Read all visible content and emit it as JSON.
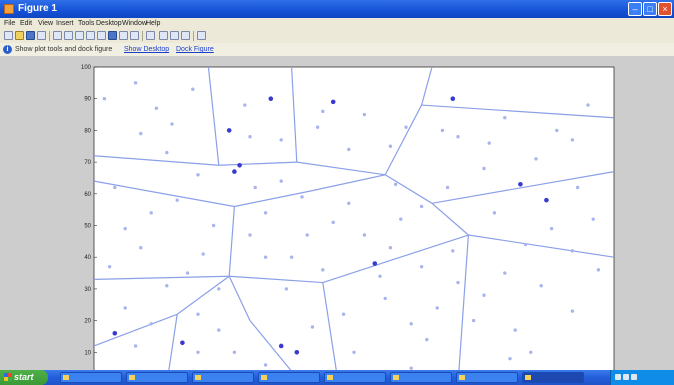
{
  "window": {
    "title": "Figure 1"
  },
  "menu": [
    "File",
    "Edit",
    "View",
    "Insert",
    "Tools",
    "Desktop",
    "Window",
    "Help"
  ],
  "infobar": {
    "text": "Show plot tools and dock figure",
    "link1": "Show Desktop",
    "link2": "Dock Figure"
  },
  "chart_data": {
    "type": "scatter",
    "title": "",
    "xlabel": "",
    "ylabel": "",
    "xlim": [
      0,
      100
    ],
    "ylim": [
      0,
      100
    ],
    "xticks": [
      0,
      10,
      20,
      30,
      40,
      50,
      60,
      70,
      80,
      90,
      100
    ],
    "yticks": [
      0,
      10,
      20,
      30,
      40,
      50,
      60,
      70,
      80,
      90,
      100
    ],
    "colors": {
      "edges": "#8ba0e8",
      "sites": "#3a3ad0",
      "points": "#a9b4ec"
    },
    "sites": [
      [
        34,
        90
      ],
      [
        46,
        89
      ],
      [
        26,
        80
      ],
      [
        27,
        67
      ],
      [
        28,
        69
      ],
      [
        54,
        38
      ],
      [
        4,
        16
      ],
      [
        17,
        13
      ],
      [
        36,
        12
      ],
      [
        82,
        63
      ],
      [
        69,
        90
      ],
      [
        87,
        58
      ],
      [
        39,
        10
      ]
    ],
    "voronoi_edges": [
      [
        [
          0,
          72
        ],
        [
          24,
          69
        ]
      ],
      [
        [
          24,
          69
        ],
        [
          22,
          100
        ]
      ],
      [
        [
          24,
          69
        ],
        [
          39,
          70
        ]
      ],
      [
        [
          39,
          70
        ],
        [
          38,
          100
        ]
      ],
      [
        [
          39,
          70
        ],
        [
          56,
          66
        ]
      ],
      [
        [
          56,
          66
        ],
        [
          63,
          88
        ]
      ],
      [
        [
          63,
          88
        ],
        [
          65,
          100
        ]
      ],
      [
        [
          63,
          88
        ],
        [
          100,
          84
        ]
      ],
      [
        [
          56,
          66
        ],
        [
          65,
          57
        ]
      ],
      [
        [
          65,
          57
        ],
        [
          100,
          67
        ]
      ],
      [
        [
          65,
          57
        ],
        [
          72,
          47
        ]
      ],
      [
        [
          72,
          47
        ],
        [
          100,
          40
        ]
      ],
      [
        [
          72,
          47
        ],
        [
          70,
          0
        ]
      ],
      [
        [
          56,
          66
        ],
        [
          42,
          61
        ]
      ],
      [
        [
          42,
          61
        ],
        [
          27,
          56
        ]
      ],
      [
        [
          27,
          56
        ],
        [
          0,
          64
        ]
      ],
      [
        [
          27,
          56
        ],
        [
          26,
          34
        ]
      ],
      [
        [
          26,
          34
        ],
        [
          0,
          33
        ]
      ],
      [
        [
          26,
          34
        ],
        [
          44,
          32
        ]
      ],
      [
        [
          44,
          32
        ],
        [
          72,
          47
        ]
      ],
      [
        [
          44,
          32
        ],
        [
          47,
          0
        ]
      ],
      [
        [
          26,
          34
        ],
        [
          16,
          22
        ]
      ],
      [
        [
          16,
          22
        ],
        [
          14,
          0
        ]
      ],
      [
        [
          26,
          34
        ],
        [
          30,
          20
        ]
      ],
      [
        [
          30,
          20
        ],
        [
          40,
          0
        ]
      ],
      [
        [
          16,
          22
        ],
        [
          0,
          12
        ]
      ]
    ],
    "points": [
      [
        8,
        95
      ],
      [
        12,
        87
      ],
      [
        19,
        93
      ],
      [
        9,
        79
      ],
      [
        15,
        82
      ],
      [
        44,
        86
      ],
      [
        29,
        88
      ],
      [
        36,
        77
      ],
      [
        52,
        85
      ],
      [
        57,
        75
      ],
      [
        49,
        74
      ],
      [
        60,
        81
      ],
      [
        67,
        80
      ],
      [
        70,
        78
      ],
      [
        76,
        76
      ],
      [
        79,
        84
      ],
      [
        89,
        80
      ],
      [
        92,
        77
      ],
      [
        85,
        71
      ],
      [
        75,
        68
      ],
      [
        68,
        62
      ],
      [
        63,
        56
      ],
      [
        59,
        52
      ],
      [
        52,
        47
      ],
      [
        46,
        51
      ],
      [
        40,
        59
      ],
      [
        36,
        64
      ],
      [
        31,
        62
      ],
      [
        33,
        54
      ],
      [
        30,
        47
      ],
      [
        23,
        50
      ],
      [
        21,
        41
      ],
      [
        18,
        35
      ],
      [
        14,
        31
      ],
      [
        9,
        43
      ],
      [
        11,
        54
      ],
      [
        6,
        49
      ],
      [
        3,
        37
      ],
      [
        6,
        24
      ],
      [
        11,
        19
      ],
      [
        20,
        22
      ],
      [
        24,
        17
      ],
      [
        27,
        10
      ],
      [
        33,
        6
      ],
      [
        42,
        18
      ],
      [
        48,
        22
      ],
      [
        56,
        27
      ],
      [
        61,
        19
      ],
      [
        66,
        24
      ],
      [
        64,
        14
      ],
      [
        75,
        28
      ],
      [
        79,
        35
      ],
      [
        86,
        31
      ],
      [
        92,
        42
      ],
      [
        97,
        36
      ],
      [
        96,
        52
      ],
      [
        83,
        44
      ],
      [
        77,
        54
      ],
      [
        88,
        49
      ],
      [
        81,
        17
      ],
      [
        84,
        10
      ],
      [
        92,
        23
      ],
      [
        69,
        42
      ],
      [
        80,
        8
      ],
      [
        70,
        32
      ],
      [
        63,
        37
      ],
      [
        57,
        43
      ],
      [
        50,
        10
      ],
      [
        44,
        36
      ],
      [
        38,
        40
      ],
      [
        4,
        62
      ],
      [
        2,
        90
      ],
      [
        16,
        58
      ],
      [
        33,
        40
      ],
      [
        37,
        30
      ],
      [
        93,
        62
      ],
      [
        58,
        63
      ],
      [
        49,
        57
      ],
      [
        41,
        47
      ],
      [
        30,
        78
      ],
      [
        43,
        81
      ],
      [
        20,
        66
      ],
      [
        14,
        73
      ],
      [
        95,
        88
      ],
      [
        73,
        20
      ],
      [
        61,
        5
      ],
      [
        55,
        34
      ],
      [
        24,
        30
      ],
      [
        20,
        10
      ],
      [
        8,
        12
      ]
    ]
  }
}
